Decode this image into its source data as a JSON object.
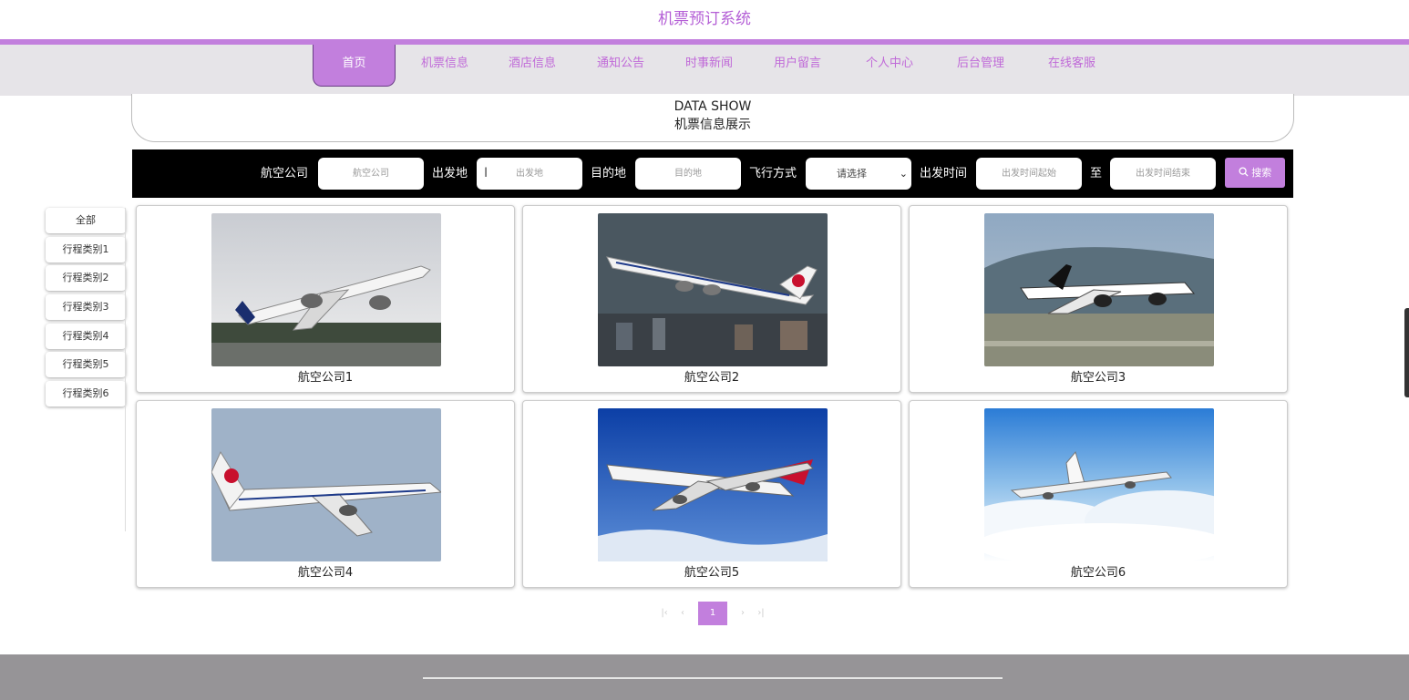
{
  "site": {
    "title": "机票预订系统"
  },
  "nav": {
    "items": [
      {
        "label": "首页",
        "active": true
      },
      {
        "label": "机票信息"
      },
      {
        "label": "酒店信息"
      },
      {
        "label": "通知公告"
      },
      {
        "label": "时事新闻"
      },
      {
        "label": "用户留言"
      },
      {
        "label": "个人中心"
      },
      {
        "label": "后台管理"
      },
      {
        "label": "在线客服"
      }
    ]
  },
  "section": {
    "title_en": "DATA SHOW",
    "title_cn": "机票信息展示"
  },
  "search": {
    "airline_label": "航空公司",
    "airline_placeholder": "航空公司",
    "from_label": "出发地",
    "from_placeholder": "出发地",
    "to_label": "目的地",
    "to_placeholder": "目的地",
    "flight_type_label": "飞行方式",
    "flight_type_value": "请选择",
    "time_label": "出发时间",
    "time_start_placeholder": "出发时间起始",
    "time_sep": "至",
    "time_end_placeholder": "出发时间结束",
    "button_label": "搜索"
  },
  "sidebar": {
    "items": [
      {
        "label": "全部"
      },
      {
        "label": "行程类别1"
      },
      {
        "label": "行程类别2"
      },
      {
        "label": "行程类别3"
      },
      {
        "label": "行程类别4"
      },
      {
        "label": "行程类别5"
      },
      {
        "label": "行程类别6"
      }
    ]
  },
  "cards": [
    {
      "caption": "航空公司1",
      "icon": "airplane-photo"
    },
    {
      "caption": "航空公司2",
      "icon": "airplane-photo"
    },
    {
      "caption": "航空公司3",
      "icon": "airplane-photo"
    },
    {
      "caption": "航空公司4",
      "icon": "airplane-photo"
    },
    {
      "caption": "航空公司5",
      "icon": "airplane-photo"
    },
    {
      "caption": "航空公司6",
      "icon": "airplane-photo"
    }
  ],
  "pagination": {
    "current": "1",
    "first": "|‹",
    "prev": "‹",
    "next": "›",
    "last": "›|"
  },
  "colors": {
    "accent": "#c27fdd",
    "title": "#b45fd6",
    "nav_bg": "#e6e4e8",
    "footer": "#969497"
  }
}
